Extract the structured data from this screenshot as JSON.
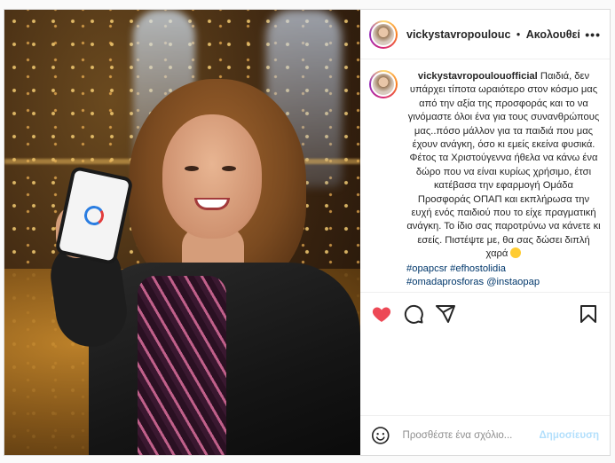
{
  "post": {
    "username": "vickystavropoulouc",
    "separator": "•",
    "follow_label": "Ακολουθείτε",
    "more_label": "•••"
  },
  "caption": {
    "username": "vickystavropoulouofficial",
    "paragraph1": "Παιδιά, δεν υπάρχει τίποτα ωραιότερο στον κόσμο μας από την αξία της προσφοράς και το να γινόμαστε όλοι ένα για τους συνανθρώπους μας..πόσο μάλλον για τα παιδιά που μας έχουν ανάγκη, όσο κι εμείς εκείνα φυσικά.",
    "paragraph2": "Φέτος τα Χριστούγεννα ήθελα να κάνω ένα δώρο που να είναι κυρίως χρήσιμο, έτσι κατέβασα την εφαρμογή Ομάδα Προσφοράς ΟΠΑΠ και εκπλήρωσα την ευχή ενός παιδιού που το είχε πραγματική ανάγκη. Το ίδιο σας παροτρύνω να κάνετε κι εσείς. Πιστέψτε με, θα σας δώσει διπλή χαρά",
    "hashtags": [
      "#opapcsr",
      "#efhostolidia",
      "#omadaprosforas"
    ],
    "mention": "@instaopap"
  },
  "icons": {
    "like": "heart-icon",
    "comment": "comment-icon",
    "share": "share-icon",
    "save": "bookmark-icon",
    "emoji": "emoji-icon",
    "more": "more-icon"
  },
  "colors": {
    "like_red": "#ed4956",
    "link_blue": "#00376b",
    "post_button": "#b2dffc"
  },
  "comment_box": {
    "placeholder": "Προσθέστε ένα σχόλιο...",
    "post_label": "Δημοσίευση"
  }
}
